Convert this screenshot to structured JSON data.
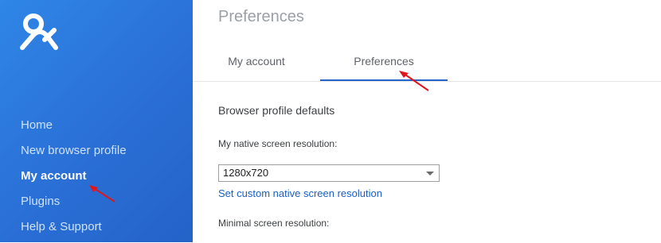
{
  "app": {
    "logo_icon": "user-logo-icon",
    "accent_color": "#2463c8"
  },
  "sidebar": {
    "items": [
      {
        "label": "Home",
        "active": false
      },
      {
        "label": "New browser profile",
        "active": false
      },
      {
        "label": "My account",
        "active": true
      },
      {
        "label": "Plugins",
        "active": false
      },
      {
        "label": "Help & Support",
        "active": false
      }
    ]
  },
  "main": {
    "page_title": "Preferences",
    "tabs": [
      {
        "label": "My account",
        "active": false
      },
      {
        "label": "Preferences",
        "active": true
      }
    ],
    "section_title": "Browser profile defaults",
    "native_resolution": {
      "label": "My native screen resolution:",
      "value": "1280x720",
      "link": "Set custom native screen resolution"
    },
    "minimal_resolution": {
      "label": "Minimal screen resolution:"
    }
  },
  "annotations": {
    "arrow_color": "#e0161b"
  }
}
